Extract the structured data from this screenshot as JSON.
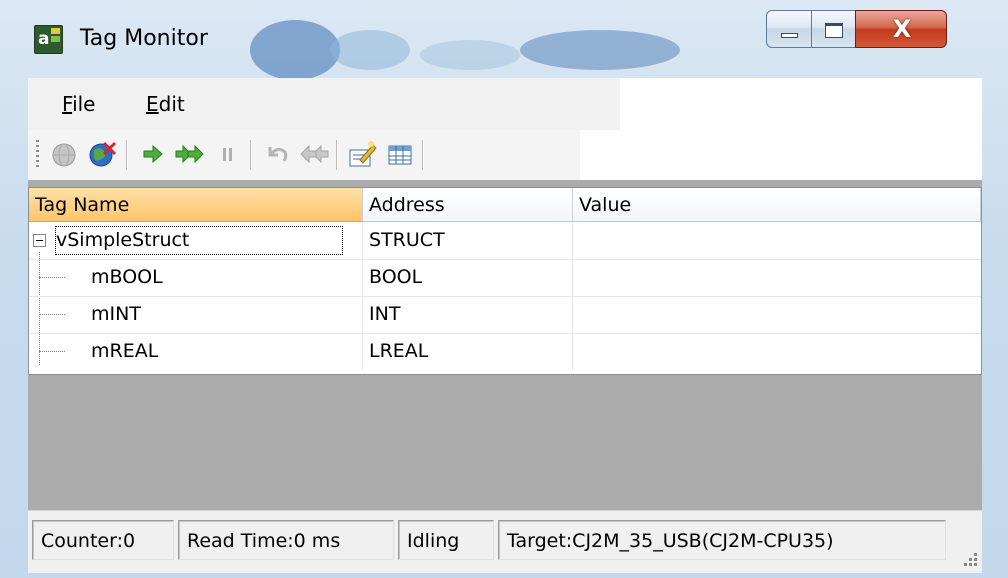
{
  "window": {
    "title": "Tag Monitor"
  },
  "title_bar": {
    "minimize_icon": "minimize-icon",
    "maximize_icon": "maximize-icon",
    "close_label": "X"
  },
  "menu": {
    "items": [
      {
        "label": "File",
        "mnemonic": "F"
      },
      {
        "label": "Edit",
        "mnemonic": "E"
      }
    ]
  },
  "toolbar": {
    "buttons": [
      {
        "icon": "connect-icon",
        "enabled": false
      },
      {
        "icon": "disconnect-icon",
        "enabled": true
      },
      {
        "icon": "step-icon",
        "enabled": true
      },
      {
        "icon": "run-icon",
        "enabled": true
      },
      {
        "icon": "pause-icon",
        "enabled": false
      },
      {
        "icon": "undo-icon",
        "enabled": false
      },
      {
        "icon": "reverse-icon",
        "enabled": false
      },
      {
        "icon": "edit-tag-icon",
        "enabled": true
      },
      {
        "icon": "table-icon",
        "enabled": true
      }
    ]
  },
  "grid": {
    "columns": [
      {
        "label": "Tag Name",
        "sorted": true
      },
      {
        "label": "Address",
        "sorted": false
      },
      {
        "label": "Value",
        "sorted": false
      }
    ],
    "rows": [
      {
        "name": "vSimpleStruct",
        "address": "STRUCT",
        "value": "",
        "expanded": true,
        "level": 0
      },
      {
        "name": "mBOOL",
        "address": "BOOL",
        "value": "",
        "level": 1
      },
      {
        "name": "mINT",
        "address": "INT",
        "value": "",
        "level": 1
      },
      {
        "name": "mREAL",
        "address": "LREAL",
        "value": "",
        "level": 1
      }
    ]
  },
  "status": {
    "counter": "Counter:0",
    "read_time": "Read Time:0 ms",
    "state": "Idling",
    "target": "Target:CJ2M_35_USB(CJ2M-CPU35)"
  },
  "colors": {
    "header_sorted": "#ffc56a",
    "close_button": "#c23b1c",
    "empty_area": "#ababab",
    "frame": "#c9dcee"
  }
}
